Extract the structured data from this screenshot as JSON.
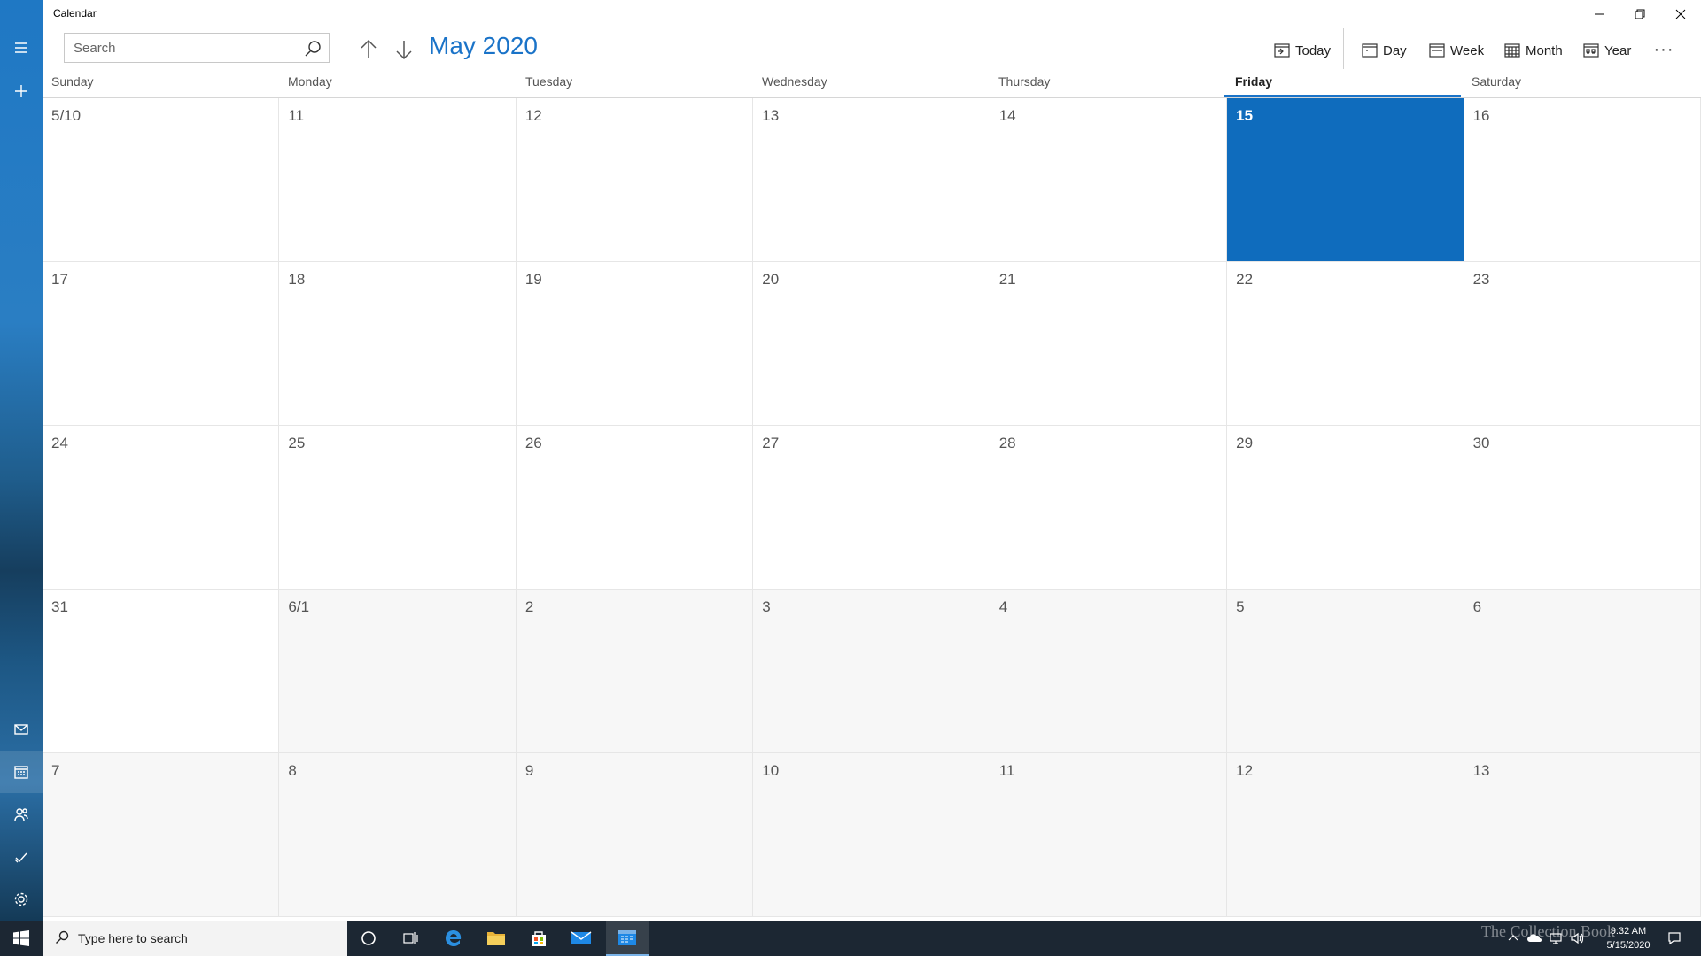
{
  "window": {
    "title": "Calendar"
  },
  "toolbar": {
    "search_placeholder": "Search",
    "month_title": "May 2020",
    "views": [
      {
        "label": "Today",
        "icon": "today-icon"
      },
      {
        "label": "Day",
        "icon": "day-view-icon"
      },
      {
        "label": "Week",
        "icon": "week-view-icon"
      },
      {
        "label": "Month",
        "icon": "month-view-icon"
      },
      {
        "label": "Year",
        "icon": "year-view-icon"
      }
    ],
    "more_label": "···"
  },
  "rail": {
    "top_items": [
      "hamburger-menu-icon",
      "new-event-icon"
    ],
    "bottom_items": [
      "mail-icon",
      "calendar-icon",
      "people-icon",
      "todo-icon",
      "settings-icon"
    ]
  },
  "calendar": {
    "day_names": [
      "Sunday",
      "Monday",
      "Tuesday",
      "Wednesday",
      "Thursday",
      "Friday",
      "Saturday"
    ],
    "today_index": 5,
    "weeks": [
      [
        {
          "label": "5/10",
          "current_month": true,
          "today": false
        },
        {
          "label": "11",
          "current_month": true,
          "today": false
        },
        {
          "label": "12",
          "current_month": true,
          "today": false
        },
        {
          "label": "13",
          "current_month": true,
          "today": false
        },
        {
          "label": "14",
          "current_month": true,
          "today": false
        },
        {
          "label": "15",
          "current_month": true,
          "today": true
        },
        {
          "label": "16",
          "current_month": true,
          "today": false
        }
      ],
      [
        {
          "label": "17",
          "current_month": true,
          "today": false
        },
        {
          "label": "18",
          "current_month": true,
          "today": false
        },
        {
          "label": "19",
          "current_month": true,
          "today": false
        },
        {
          "label": "20",
          "current_month": true,
          "today": false
        },
        {
          "label": "21",
          "current_month": true,
          "today": false
        },
        {
          "label": "22",
          "current_month": true,
          "today": false
        },
        {
          "label": "23",
          "current_month": true,
          "today": false
        }
      ],
      [
        {
          "label": "24",
          "current_month": true,
          "today": false
        },
        {
          "label": "25",
          "current_month": true,
          "today": false
        },
        {
          "label": "26",
          "current_month": true,
          "today": false
        },
        {
          "label": "27",
          "current_month": true,
          "today": false
        },
        {
          "label": "28",
          "current_month": true,
          "today": false
        },
        {
          "label": "29",
          "current_month": true,
          "today": false
        },
        {
          "label": "30",
          "current_month": true,
          "today": false
        }
      ],
      [
        {
          "label": "31",
          "current_month": true,
          "today": false
        },
        {
          "label": "6/1",
          "current_month": false,
          "today": false
        },
        {
          "label": "2",
          "current_month": false,
          "today": false
        },
        {
          "label": "3",
          "current_month": false,
          "today": false
        },
        {
          "label": "4",
          "current_month": false,
          "today": false
        },
        {
          "label": "5",
          "current_month": false,
          "today": false
        },
        {
          "label": "6",
          "current_month": false,
          "today": false
        }
      ],
      [
        {
          "label": "7",
          "current_month": false,
          "today": false
        },
        {
          "label": "8",
          "current_month": false,
          "today": false
        },
        {
          "label": "9",
          "current_month": false,
          "today": false
        },
        {
          "label": "10",
          "current_month": false,
          "today": false
        },
        {
          "label": "11",
          "current_month": false,
          "today": false
        },
        {
          "label": "12",
          "current_month": false,
          "today": false
        },
        {
          "label": "13",
          "current_month": false,
          "today": false
        }
      ]
    ]
  },
  "taskbar": {
    "search_placeholder": "Type here to search",
    "pinned": [
      "cortana-icon",
      "task-view-icon",
      "edge-icon",
      "file-explorer-icon",
      "store-icon",
      "mail-app-icon",
      "calendar-app-icon"
    ],
    "clock_time": "9:32 AM",
    "clock_date": "5/15/2020",
    "watermark": "The Collection Book"
  },
  "colors": {
    "accent": "#1a73c8",
    "today_fill": "#0f6cbd",
    "out_of_month": "#f7f7f7",
    "taskbar": "#1c2733"
  }
}
